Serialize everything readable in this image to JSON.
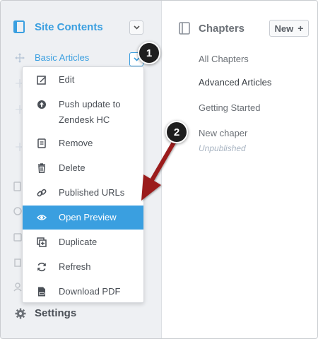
{
  "sidebar": {
    "title": "Site Contents",
    "selected_item": "Basic Articles",
    "settings_label": "Settings"
  },
  "menu": {
    "items": [
      {
        "label": "Edit",
        "icon": "edit-icon"
      },
      {
        "label": "Push update to\nZendesk HC",
        "icon": "upload-icon"
      },
      {
        "label": "Remove",
        "icon": "remove-icon"
      },
      {
        "label": "Delete",
        "icon": "trash-icon"
      },
      {
        "label": "Published URLs",
        "icon": "link-icon"
      },
      {
        "label": "Open Preview",
        "icon": "eye-icon",
        "active": true
      },
      {
        "label": "Duplicate",
        "icon": "duplicate-icon"
      },
      {
        "label": "Refresh",
        "icon": "refresh-icon"
      },
      {
        "label": "Download PDF",
        "icon": "pdf-icon"
      }
    ]
  },
  "chapters": {
    "title": "Chapters",
    "new_label": "New",
    "new_icon": "+",
    "items": [
      "All Chapters",
      "Advanced Articles",
      "Getting Started",
      "New chaper"
    ],
    "status": "Unpublished"
  },
  "annotations": {
    "step1": "1",
    "step2": "2",
    "arrow_color": "#9b1c1c"
  },
  "colors": {
    "accent": "#3a9fe0",
    "sidebar_bg": "#eef0f3"
  }
}
